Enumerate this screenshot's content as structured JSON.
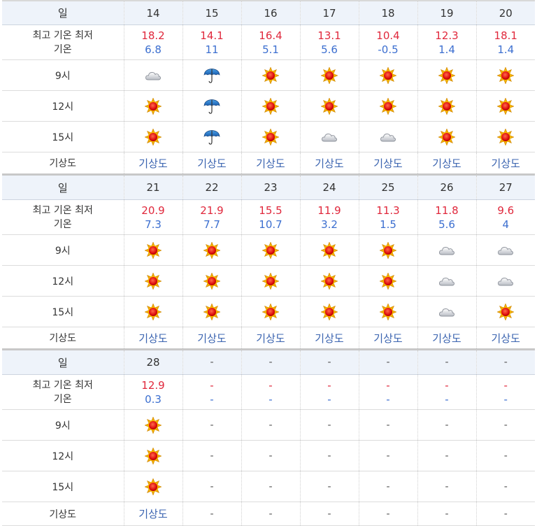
{
  "labels": {
    "day": "일",
    "temp_line1": "최고 기온 최저",
    "temp_line2": "기온",
    "t9": "9시",
    "t12": "12시",
    "t15": "15시",
    "map": "기상도"
  },
  "map_link": "기상도",
  "dash": "-",
  "weeks": [
    {
      "days": [
        {
          "day": "14",
          "hi": "18.2",
          "lo": "6.8",
          "am9": "cloud-icon",
          "pm12": "sun-icon",
          "pm15": "sun-icon"
        },
        {
          "day": "15",
          "hi": "14.1",
          "lo": "11",
          "am9": "umbrella-icon",
          "pm12": "umbrella-icon",
          "pm15": "umbrella-icon"
        },
        {
          "day": "16",
          "hi": "16.4",
          "lo": "5.1",
          "am9": "sun-icon",
          "pm12": "sun-icon",
          "pm15": "sun-icon"
        },
        {
          "day": "17",
          "hi": "13.1",
          "lo": "5.6",
          "am9": "sun-icon",
          "pm12": "sun-icon",
          "pm15": "cloud-icon"
        },
        {
          "day": "18",
          "hi": "10.4",
          "lo": "-0.5",
          "am9": "sun-icon",
          "pm12": "sun-icon",
          "pm15": "cloud-icon"
        },
        {
          "day": "19",
          "hi": "12.3",
          "lo": "1.4",
          "am9": "sun-icon",
          "pm12": "sun-icon",
          "pm15": "sun-icon"
        },
        {
          "day": "20",
          "hi": "18.1",
          "lo": "1.4",
          "am9": "sun-icon",
          "pm12": "sun-icon",
          "pm15": "sun-icon"
        }
      ]
    },
    {
      "days": [
        {
          "day": "21",
          "hi": "20.9",
          "lo": "7.3",
          "am9": "sun-icon",
          "pm12": "sun-icon",
          "pm15": "sun-icon"
        },
        {
          "day": "22",
          "hi": "21.9",
          "lo": "7.7",
          "am9": "sun-icon",
          "pm12": "sun-icon",
          "pm15": "sun-icon"
        },
        {
          "day": "23",
          "hi": "15.5",
          "lo": "10.7",
          "am9": "sun-icon",
          "pm12": "sun-icon",
          "pm15": "sun-icon"
        },
        {
          "day": "24",
          "hi": "11.9",
          "lo": "3.2",
          "am9": "sun-icon",
          "pm12": "sun-icon",
          "pm15": "sun-icon"
        },
        {
          "day": "25",
          "hi": "11.3",
          "lo": "1.5",
          "am9": "sun-icon",
          "pm12": "sun-icon",
          "pm15": "sun-icon"
        },
        {
          "day": "26",
          "hi": "11.8",
          "lo": "5.6",
          "am9": "cloud-icon",
          "pm12": "cloud-icon",
          "pm15": "cloud-icon"
        },
        {
          "day": "27",
          "hi": "9.6",
          "lo": "4",
          "am9": "cloud-icon",
          "pm12": "cloud-icon",
          "pm15": "sun-icon"
        }
      ]
    },
    {
      "days": [
        {
          "day": "28",
          "hi": "12.9",
          "lo": "0.3",
          "am9": "sun-icon",
          "pm12": "sun-icon",
          "pm15": "sun-icon",
          "map": true
        },
        {
          "day": "-",
          "hi": "-",
          "lo": "-",
          "am9": "",
          "pm12": "",
          "pm15": "",
          "empty": true
        },
        {
          "day": "-",
          "hi": "-",
          "lo": "-",
          "am9": "",
          "pm12": "",
          "pm15": "",
          "empty": true
        },
        {
          "day": "-",
          "hi": "-",
          "lo": "-",
          "am9": "",
          "pm12": "",
          "pm15": "",
          "empty": true
        },
        {
          "day": "-",
          "hi": "-",
          "lo": "-",
          "am9": "",
          "pm12": "",
          "pm15": "",
          "empty": true
        },
        {
          "day": "-",
          "hi": "-",
          "lo": "-",
          "am9": "",
          "pm12": "",
          "pm15": "",
          "empty": true
        },
        {
          "day": "-",
          "hi": "-",
          "lo": "-",
          "am9": "",
          "pm12": "",
          "pm15": "",
          "empty": true
        }
      ]
    }
  ],
  "colors": {
    "high_temp": "#e0283c",
    "low_temp": "#3c6fd0",
    "link": "#3b64b0",
    "header_bg": "#eef3fa"
  }
}
